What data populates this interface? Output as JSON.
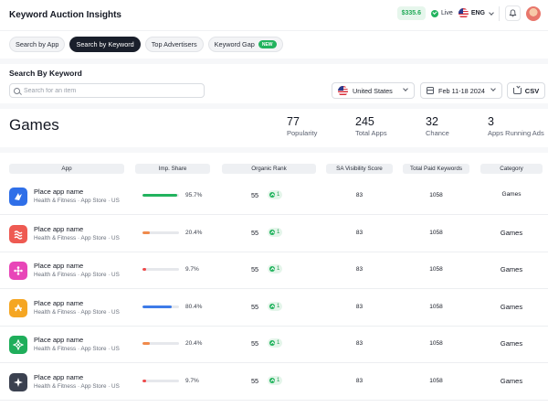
{
  "header": {
    "title": "Keyword Auction Insights",
    "balance": "$335.6",
    "live_label": "Live",
    "language": "ENG"
  },
  "tabs": [
    {
      "label": "Search by App",
      "active": false
    },
    {
      "label": "Search by Keyword",
      "active": true
    },
    {
      "label": "Top Advertisers",
      "active": false
    },
    {
      "label": "Keyword Gap",
      "active": false,
      "badge": "NEW"
    }
  ],
  "search_section": {
    "title": "Search By Keyword",
    "search_placeholder": "Search for an item",
    "country": "United States",
    "date_range": "Feb 11-18 2024",
    "export_label": "CSV"
  },
  "summary": {
    "title": "Games",
    "stats": [
      {
        "value": "77",
        "label": "Popularity"
      },
      {
        "value": "245",
        "label": "Total Apps"
      },
      {
        "value": "32",
        "label": "Chance"
      },
      {
        "value": "3",
        "label": "Apps Running Ads"
      }
    ]
  },
  "table": {
    "columns": [
      "App",
      "Imp. Share",
      "Organic Rank",
      "SA Visibility Score",
      "Total Paid Keywords",
      "Category"
    ],
    "rows": [
      {
        "name": "Place app name",
        "subtitle": "Health & Fitness · App Store · US",
        "icon": "blue-bird-icon",
        "icon_color": "#2f6fe8",
        "imp_share": "95.7%",
        "share": 0.957,
        "bar_color": "#22b35e",
        "rank": "55",
        "rank_change": "1",
        "visibility": "83",
        "paid_keywords": "1058",
        "category": "Games"
      },
      {
        "name": "Place app name",
        "subtitle": "Health & Fitness · App Store · US",
        "icon": "red-waves-icon",
        "icon_color": "#ee5a52",
        "imp_share": "20.4%",
        "share": 0.204,
        "bar_color": "#f08a4b",
        "rank": "55",
        "rank_change": "1",
        "visibility": "83",
        "paid_keywords": "1058",
        "category": "Games"
      },
      {
        "name": "Place app name",
        "subtitle": "Health & Fitness · App Store · US",
        "icon": "pink-flower-icon",
        "icon_color": "#e846b8",
        "imp_share": "9.7%",
        "share": 0.097,
        "bar_color": "#ef4b4b",
        "rank": "55",
        "rank_change": "1",
        "visibility": "83",
        "paid_keywords": "1058",
        "category": "Games"
      },
      {
        "name": "Place app name",
        "subtitle": "Health & Fitness · App Store · US",
        "icon": "orange-sun-icon",
        "icon_color": "#f5a623",
        "imp_share": "80.4%",
        "share": 0.804,
        "bar_color": "#3d7be8",
        "rank": "55",
        "rank_change": "1",
        "visibility": "83",
        "paid_keywords": "1058",
        "category": "Games"
      },
      {
        "name": "Place app name",
        "subtitle": "Health & Fitness · App Store · US",
        "icon": "green-cross-icon",
        "icon_color": "#1fae5b",
        "imp_share": "20.4%",
        "share": 0.204,
        "bar_color": "#f08a4b",
        "rank": "55",
        "rank_change": "1",
        "visibility": "83",
        "paid_keywords": "1058",
        "category": "Games"
      },
      {
        "name": "Place app name",
        "subtitle": "Health & Fitness · App Store · US",
        "icon": "dark-star-icon",
        "icon_color": "#3b4150",
        "imp_share": "9.7%",
        "share": 0.097,
        "bar_color": "#ef4b4b",
        "rank": "55",
        "rank_change": "1",
        "visibility": "83",
        "paid_keywords": "1058",
        "category": "Games"
      }
    ]
  }
}
